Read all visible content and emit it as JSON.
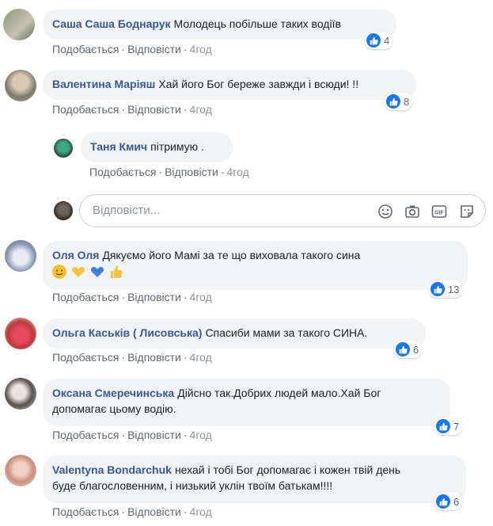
{
  "actions": {
    "like": "Подобається",
    "reply": "Відповісти",
    "sep": "·"
  },
  "reply_input": {
    "placeholder": "Відповісти..."
  },
  "comments": [
    {
      "author": "Саша Саша Боднарук",
      "text": "Молодець побільше таких водіїв",
      "time": "4год",
      "likes": "4"
    },
    {
      "author": "Валентина Маріяш",
      "text": "Хай його Бог береже завжди і всюди! !!",
      "time": "4год",
      "likes": "8"
    },
    {
      "author": "Таня Кмич",
      "text": "пітримую .",
      "time": "4год"
    },
    {
      "author": "Оля Оля",
      "text": "Дякуємо його Мамі за те що виховала такого сина",
      "time": "4год",
      "likes": "13",
      "emojis": [
        "smiling-face-icon",
        "yellow-heart-icon",
        "blue-heart-icon",
        "thumbs-up-icon"
      ]
    },
    {
      "author": "Ольга Каськів ( Лисовська)",
      "text": "Спасиби мами за такого СИНА.",
      "time": "4год",
      "likes": "6"
    },
    {
      "author": "Оксана Смеречинська",
      "text": "Дійсно так.Добрих людей мало.Хай Бог",
      "text2": "допомагає цьому водію.",
      "time": "4год",
      "likes": "7"
    },
    {
      "author": "Valentyna Bondarchuk",
      "text": "нехай і тобі Бог допомагає і кожен твій день",
      "text2": "буде благословенним, і низький уклін твоїм батькам!!!!",
      "time": "4год",
      "likes": "6"
    }
  ],
  "colors": {
    "link": "#385898",
    "bubble": "#f2f3f5",
    "like": "#1877f2"
  }
}
